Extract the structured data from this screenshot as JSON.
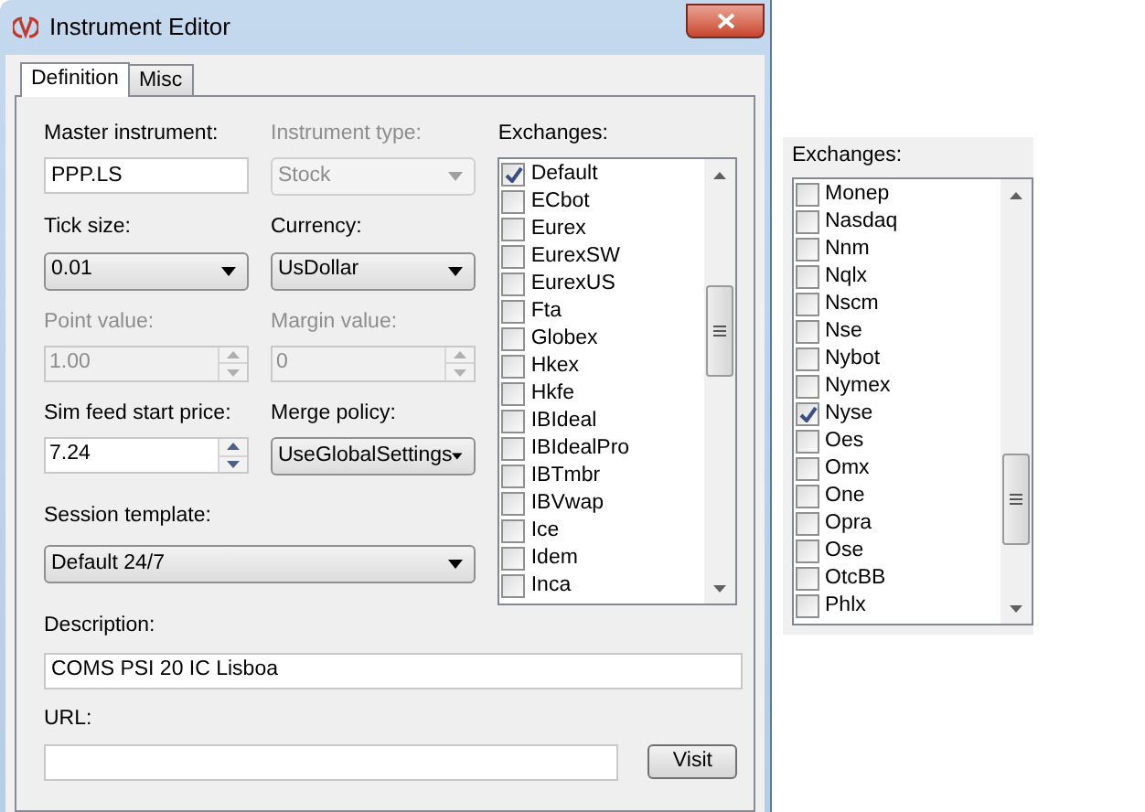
{
  "window": {
    "title": "Instrument Editor"
  },
  "tabs": [
    {
      "label": "Definition",
      "selected": true
    },
    {
      "label": "Misc",
      "selected": false
    }
  ],
  "form_rows": [
    [
      {
        "label": "Master instrument:",
        "kind": "text",
        "value": "PPP.LS",
        "disabled": false
      },
      {
        "label": "Instrument type:",
        "kind": "dropdown",
        "value": "Stock",
        "disabled": true
      }
    ],
    [
      {
        "label": "Tick size:",
        "kind": "dropdown",
        "value": "0.01",
        "disabled": false
      },
      {
        "label": "Currency:",
        "kind": "dropdown",
        "value": "UsDollar",
        "disabled": false
      }
    ],
    [
      {
        "label": "Point value:",
        "kind": "spinner",
        "value": "1.00",
        "disabled": true
      },
      {
        "label": "Margin value:",
        "kind": "spinner",
        "value": "0",
        "disabled": true
      }
    ],
    [
      {
        "label": "Sim feed start price:",
        "kind": "spinner",
        "value": "7.24",
        "disabled": false
      },
      {
        "label": "Merge policy:",
        "kind": "dropdown",
        "value": "UseGlobalSettings",
        "disabled": false
      }
    ]
  ],
  "session_template": {
    "label": "Session template:",
    "value": "Default 24/7"
  },
  "description": {
    "label": "Description:",
    "value": "COMS PSI 20 IC Lisboa"
  },
  "url": {
    "label": "URL:",
    "button": "Visit"
  },
  "exchanges": {
    "label": "Exchanges:",
    "items": [
      {
        "name": "Default",
        "checked": true
      },
      {
        "name": "ECbot",
        "checked": false
      },
      {
        "name": "Eurex",
        "checked": false
      },
      {
        "name": "EurexSW",
        "checked": false
      },
      {
        "name": "EurexUS",
        "checked": false
      },
      {
        "name": "Fta",
        "checked": false
      },
      {
        "name": "Globex",
        "checked": false
      },
      {
        "name": "Hkex",
        "checked": false
      },
      {
        "name": "Hkfe",
        "checked": false
      },
      {
        "name": "IBIdeal",
        "checked": false
      },
      {
        "name": "IBIdealPro",
        "checked": false
      },
      {
        "name": "IBTmbr",
        "checked": false
      },
      {
        "name": "IBVwap",
        "checked": false
      },
      {
        "name": "Ice",
        "checked": false
      },
      {
        "name": "Idem",
        "checked": false
      },
      {
        "name": "Inca",
        "checked": false
      }
    ]
  },
  "exchanges_scrolled": {
    "label": "Exchanges:",
    "items": [
      {
        "name": "Monep",
        "checked": false
      },
      {
        "name": "Nasdaq",
        "checked": false
      },
      {
        "name": "Nnm",
        "checked": false
      },
      {
        "name": "Nqlx",
        "checked": false
      },
      {
        "name": "Nscm",
        "checked": false
      },
      {
        "name": "Nse",
        "checked": false
      },
      {
        "name": "Nybot",
        "checked": false
      },
      {
        "name": "Nymex",
        "checked": false
      },
      {
        "name": "Nyse",
        "checked": true
      },
      {
        "name": "Oes",
        "checked": false
      },
      {
        "name": "Omx",
        "checked": false
      },
      {
        "name": "One",
        "checked": false
      },
      {
        "name": "Opra",
        "checked": false
      },
      {
        "name": "Ose",
        "checked": false
      },
      {
        "name": "OtcBB",
        "checked": false
      },
      {
        "name": "Phlx",
        "checked": false
      }
    ]
  }
}
